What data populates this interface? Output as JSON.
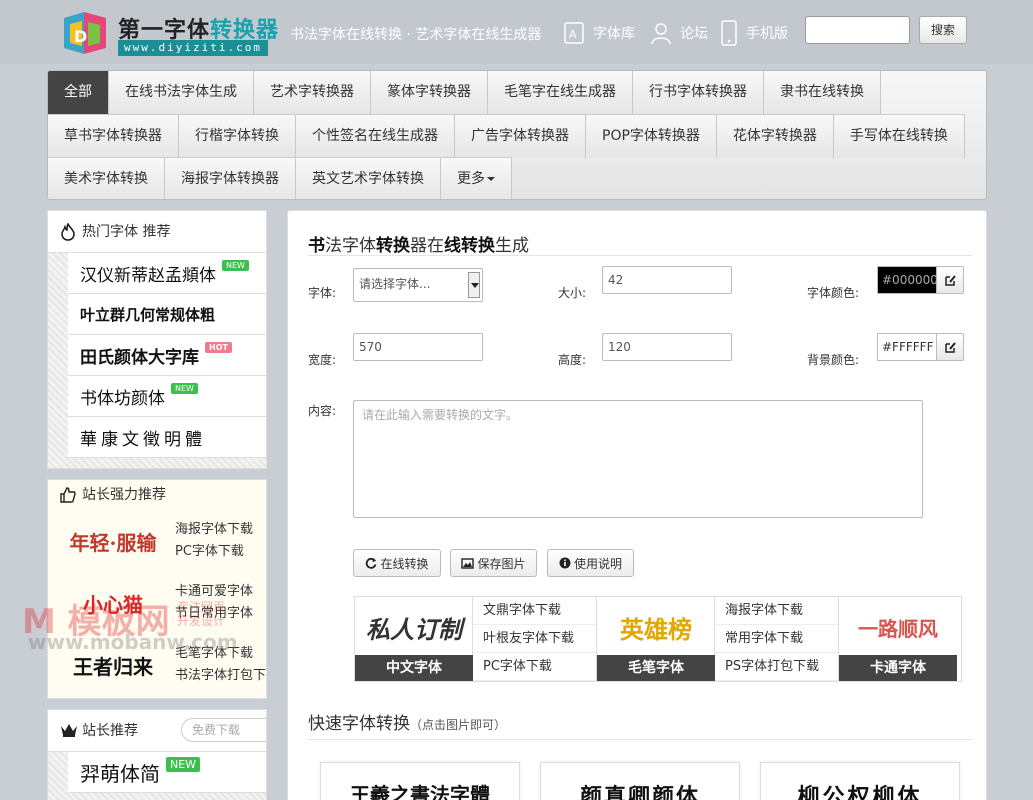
{
  "header": {
    "logo_title_prefix": "第一字体",
    "logo_title_highlight": "转换器",
    "logo_url": "www.diyiziti.com",
    "slogan": "书法字体在线转换 · 艺术字体在线生成器",
    "links": [
      {
        "label": "字体库",
        "icon": "font-library-icon"
      },
      {
        "label": "论坛",
        "icon": "user-icon"
      },
      {
        "label": "手机版",
        "icon": "mobile-phone-icon"
      }
    ],
    "search_placeholder": "",
    "search_button": "搜索"
  },
  "nav": {
    "rows": [
      [
        "全部",
        "在线书法字体生成",
        "艺术字转换器",
        "篆体字转换器",
        "毛笔字在线生成器",
        "行书字体转换器",
        "隶书在线转换"
      ],
      [
        "草书字体转换器",
        "行楷字体转换",
        "个性签名在线生成器",
        "广告字体转换器",
        "POP字体转换器",
        "花体字转换器",
        "手写体在线转换"
      ],
      [
        "美术字体转换",
        "海报字体转换器",
        "英文艺术字体转换",
        "更多"
      ]
    ],
    "active": "全部"
  },
  "hot_fonts": {
    "title": "热门字体  推荐",
    "items": [
      {
        "name": "汉仪新蒂赵孟頫体",
        "tag": "NEW"
      },
      {
        "name": "叶立群几何常规体粗",
        "tag": ""
      },
      {
        "name": "田氏颜体大字库",
        "tag": "HOT"
      },
      {
        "name": "书体坊颜体",
        "tag": "NEW"
      },
      {
        "name": "華康文徵明體",
        "tag": ""
      }
    ]
  },
  "webmaster_recommend": {
    "title": "站长强力推荐",
    "rows": [
      {
        "image_text": "年轻·服输",
        "links": [
          "海报字体下载",
          "PC字体下载"
        ]
      },
      {
        "image_text": "小心猫",
        "links": [
          "卡通可爱字体",
          "节日常用字体"
        ]
      },
      {
        "image_text": "王者归来",
        "links": [
          "毛笔字体下载",
          "书法字体打包下"
        ]
      }
    ]
  },
  "watermark": {
    "brand": "M 模板网",
    "url": "www.mobanw.com",
    "subtitle1": "专注网页",
    "subtitle2": "开发设计"
  },
  "site_recommend": {
    "title": "站长推荐",
    "search_placeholder": "免费下载",
    "first_item": {
      "name": "羿萌体简",
      "tag": "NEW"
    }
  },
  "main": {
    "title_parts": [
      "书",
      "法字体",
      "转换",
      "器在",
      "线转换",
      "生成"
    ],
    "labels": {
      "font": "字体:",
      "size": "大小:",
      "font_color": "字体颜色:",
      "width": "宽度:",
      "height": "高度:",
      "bg_color": "背景颜色:",
      "content": "内容:"
    },
    "font_select_value": "请选择字体...",
    "size_value": "42",
    "font_color_value": "#000000",
    "width_value": "570",
    "height_value": "120",
    "bg_color_value": "#FFFFFF",
    "content_placeholder": "请在此输入需要转换的文字。",
    "buttons": {
      "convert": "在线转换",
      "save": "保存图片",
      "help": "使用说明"
    },
    "banner": {
      "blocks": [
        {
          "image_text": "私人订制",
          "caption": "中文字体",
          "links": [
            "文鼎字体下载",
            "叶根友字体下载",
            "PC字体下载"
          ]
        },
        {
          "image_text": "英雄榜",
          "caption": "毛笔字体",
          "links": [
            "海报字体下载",
            "常用字体下载",
            "PS字体打包下载"
          ]
        },
        {
          "image_text": "一路顺风",
          "caption": "卡通字体",
          "links": []
        }
      ]
    },
    "quick_title": "快速字体转换",
    "quick_hint": "（点击图片即可）",
    "quick_cards": [
      "王羲之書法字體",
      "颜真卿颜体",
      "柳公权柳体"
    ]
  },
  "colors": {
    "accent": "#17a3ab",
    "nav_active": "#444444",
    "tag_new": "#3cbf4d",
    "tag_hot": "#f27a8a"
  }
}
